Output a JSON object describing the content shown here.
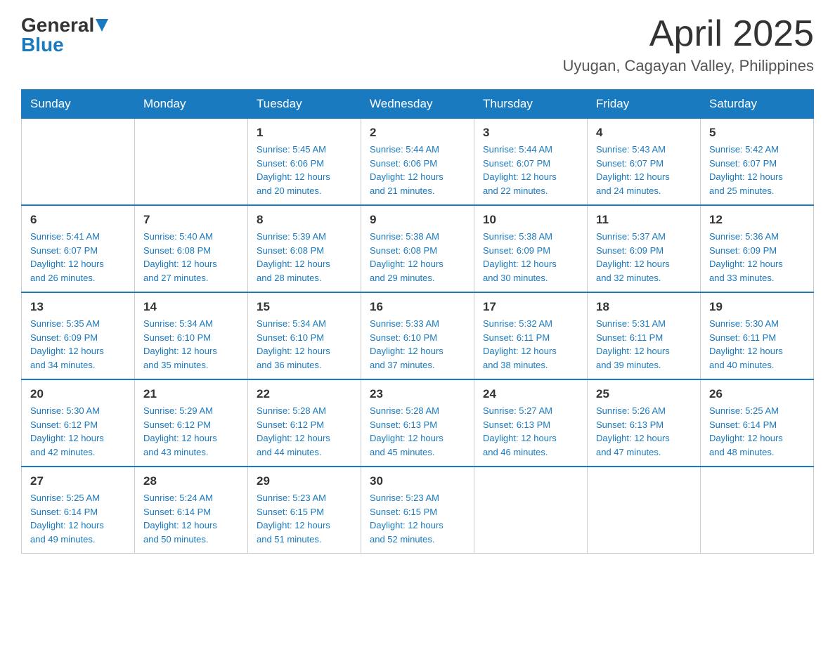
{
  "header": {
    "logo": {
      "general": "General",
      "blue": "Blue"
    },
    "title": "April 2025",
    "location": "Uyugan, Cagayan Valley, Philippines"
  },
  "calendar": {
    "days_of_week": [
      "Sunday",
      "Monday",
      "Tuesday",
      "Wednesday",
      "Thursday",
      "Friday",
      "Saturday"
    ],
    "weeks": [
      [
        {
          "day": "",
          "info": ""
        },
        {
          "day": "",
          "info": ""
        },
        {
          "day": "1",
          "info": "Sunrise: 5:45 AM\nSunset: 6:06 PM\nDaylight: 12 hours\nand 20 minutes."
        },
        {
          "day": "2",
          "info": "Sunrise: 5:44 AM\nSunset: 6:06 PM\nDaylight: 12 hours\nand 21 minutes."
        },
        {
          "day": "3",
          "info": "Sunrise: 5:44 AM\nSunset: 6:07 PM\nDaylight: 12 hours\nand 22 minutes."
        },
        {
          "day": "4",
          "info": "Sunrise: 5:43 AM\nSunset: 6:07 PM\nDaylight: 12 hours\nand 24 minutes."
        },
        {
          "day": "5",
          "info": "Sunrise: 5:42 AM\nSunset: 6:07 PM\nDaylight: 12 hours\nand 25 minutes."
        }
      ],
      [
        {
          "day": "6",
          "info": "Sunrise: 5:41 AM\nSunset: 6:07 PM\nDaylight: 12 hours\nand 26 minutes."
        },
        {
          "day": "7",
          "info": "Sunrise: 5:40 AM\nSunset: 6:08 PM\nDaylight: 12 hours\nand 27 minutes."
        },
        {
          "day": "8",
          "info": "Sunrise: 5:39 AM\nSunset: 6:08 PM\nDaylight: 12 hours\nand 28 minutes."
        },
        {
          "day": "9",
          "info": "Sunrise: 5:38 AM\nSunset: 6:08 PM\nDaylight: 12 hours\nand 29 minutes."
        },
        {
          "day": "10",
          "info": "Sunrise: 5:38 AM\nSunset: 6:09 PM\nDaylight: 12 hours\nand 30 minutes."
        },
        {
          "day": "11",
          "info": "Sunrise: 5:37 AM\nSunset: 6:09 PM\nDaylight: 12 hours\nand 32 minutes."
        },
        {
          "day": "12",
          "info": "Sunrise: 5:36 AM\nSunset: 6:09 PM\nDaylight: 12 hours\nand 33 minutes."
        }
      ],
      [
        {
          "day": "13",
          "info": "Sunrise: 5:35 AM\nSunset: 6:09 PM\nDaylight: 12 hours\nand 34 minutes."
        },
        {
          "day": "14",
          "info": "Sunrise: 5:34 AM\nSunset: 6:10 PM\nDaylight: 12 hours\nand 35 minutes."
        },
        {
          "day": "15",
          "info": "Sunrise: 5:34 AM\nSunset: 6:10 PM\nDaylight: 12 hours\nand 36 minutes."
        },
        {
          "day": "16",
          "info": "Sunrise: 5:33 AM\nSunset: 6:10 PM\nDaylight: 12 hours\nand 37 minutes."
        },
        {
          "day": "17",
          "info": "Sunrise: 5:32 AM\nSunset: 6:11 PM\nDaylight: 12 hours\nand 38 minutes."
        },
        {
          "day": "18",
          "info": "Sunrise: 5:31 AM\nSunset: 6:11 PM\nDaylight: 12 hours\nand 39 minutes."
        },
        {
          "day": "19",
          "info": "Sunrise: 5:30 AM\nSunset: 6:11 PM\nDaylight: 12 hours\nand 40 minutes."
        }
      ],
      [
        {
          "day": "20",
          "info": "Sunrise: 5:30 AM\nSunset: 6:12 PM\nDaylight: 12 hours\nand 42 minutes."
        },
        {
          "day": "21",
          "info": "Sunrise: 5:29 AM\nSunset: 6:12 PM\nDaylight: 12 hours\nand 43 minutes."
        },
        {
          "day": "22",
          "info": "Sunrise: 5:28 AM\nSunset: 6:12 PM\nDaylight: 12 hours\nand 44 minutes."
        },
        {
          "day": "23",
          "info": "Sunrise: 5:28 AM\nSunset: 6:13 PM\nDaylight: 12 hours\nand 45 minutes."
        },
        {
          "day": "24",
          "info": "Sunrise: 5:27 AM\nSunset: 6:13 PM\nDaylight: 12 hours\nand 46 minutes."
        },
        {
          "day": "25",
          "info": "Sunrise: 5:26 AM\nSunset: 6:13 PM\nDaylight: 12 hours\nand 47 minutes."
        },
        {
          "day": "26",
          "info": "Sunrise: 5:25 AM\nSunset: 6:14 PM\nDaylight: 12 hours\nand 48 minutes."
        }
      ],
      [
        {
          "day": "27",
          "info": "Sunrise: 5:25 AM\nSunset: 6:14 PM\nDaylight: 12 hours\nand 49 minutes."
        },
        {
          "day": "28",
          "info": "Sunrise: 5:24 AM\nSunset: 6:14 PM\nDaylight: 12 hours\nand 50 minutes."
        },
        {
          "day": "29",
          "info": "Sunrise: 5:23 AM\nSunset: 6:15 PM\nDaylight: 12 hours\nand 51 minutes."
        },
        {
          "day": "30",
          "info": "Sunrise: 5:23 AM\nSunset: 6:15 PM\nDaylight: 12 hours\nand 52 minutes."
        },
        {
          "day": "",
          "info": ""
        },
        {
          "day": "",
          "info": ""
        },
        {
          "day": "",
          "info": ""
        }
      ]
    ]
  }
}
